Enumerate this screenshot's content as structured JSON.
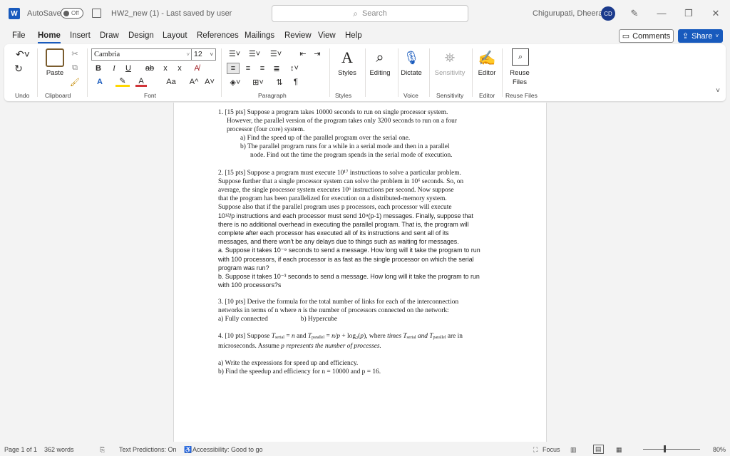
{
  "titlebar": {
    "autosave_label": "AutoSave",
    "autosave_state": "Off",
    "doc_title": "HW2_new (1)  -  Last saved by user",
    "search_placeholder": "Search",
    "user_name": "Chigurupati, Dheeraj",
    "user_initials": "CD"
  },
  "menu": {
    "tabs": [
      "File",
      "Home",
      "Insert",
      "Draw",
      "Design",
      "Layout",
      "References",
      "Mailings",
      "Review",
      "View",
      "Help"
    ],
    "active_tab": "Home",
    "comments_label": "Comments",
    "share_label": "Share"
  },
  "ribbon": {
    "groups": {
      "undo": "Undo",
      "clipboard": "Clipboard",
      "font": "Font",
      "paragraph": "Paragraph",
      "styles": "Styles",
      "voice": "Voice",
      "sensitivity": "Sensitivity",
      "editor": "Editor",
      "reuse_files": "Reuse Files"
    },
    "paste_label": "Paste",
    "font_name": "Cambria",
    "font_size": "12",
    "styles_label": "Styles",
    "editing_label": "Editing",
    "dictate_label": "Dictate",
    "sensitivity_label": "Sensitivity",
    "editor_label": "Editor",
    "reuse_label_1": "Reuse",
    "reuse_label_2": "Files",
    "bold": "B",
    "italic": "I",
    "underline": "U",
    "strike": "ab",
    "subscript": "x",
    "superscript": "x",
    "font_case": "Aa",
    "grow": "A^",
    "shrink": "A˅",
    "pilcrow": "¶"
  },
  "document": {
    "q1_line1": "1.  [15 pts] Suppose a program takes 10000 seconds to run on single processor system.",
    "q1_line2": "However, the parallel version of the program takes only 3200 seconds to run on a four",
    "q1_line3": "processor (four core) system.",
    "q1_a": "a)  Find the speed up of the parallel program over the serial one.",
    "q1_b1": "b)  The parallel program runs for a while in a serial mode and then in a parallel",
    "q1_b2": "node. Find out the time the program spends in the serial mode of execution.",
    "q2_l1": "2. [15 pts] Suppose a program must execute 10¹⁷ instructions to solve a particular problem.",
    "q2_l2": "Suppose further that a single processor system can solve the problem in 10⁶ seconds. So, on",
    "q2_l3": "average, the single processor system executes 10⁶ instructions per second. Now suppose",
    "q2_l4": "that the program has been parallelized for execution on a distributed-memory system.",
    "q2_l5": "Suppose also that if the parallel program uses p processors, each processor will execute",
    "q2_l6": "10¹²/p instructions and each processor must send 10⁹(p-1) messages. Finally, suppose that",
    "q2_l7": "there is no additional overhead in executing the parallel program. That is, the program will",
    "q2_l8": "complete after each processor has executed all of its instructions and sent all of its",
    "q2_l9": "messages, and there won't be any delays due to things such as waiting for messages.",
    "q2_l10": "a. Suppose it takes 10⁻⁹ seconds to send a message. How long will it take the program to run",
    "q2_l11": "with 100 processors, if each processor is as fast as the single processor on which the serial",
    "q2_l12": "program was run?",
    "q2_l13": "b. Suppose it takes 10⁻³ seconds to send a message. How long will it take the program to run",
    "q2_l14": "with 100 processors?s",
    "q3_l1": "3. [10 pts] Derive the formula for the total number of links for each of the interconnection",
    "q3_l2_a": "networks in terms of n where ",
    "q3_l2_n": "n",
    "q3_l2_b": " is the number of processors connected on the network:",
    "q3_a": "a) Fully connected",
    "q3_b": "b) Hypercube",
    "q4_l1_a": "4. [10 pts] Suppose ",
    "q4_T": "T",
    "q4_serial": "serial",
    "q4_l1_b": " = ",
    "q4_n": "n",
    "q4_l1_c": " and ",
    "q4_parallel": "parallel",
    "q4_l1_d": " = ",
    "q4_np": "n/p",
    "q4_l1_e": " + log₂(",
    "q4_p": "p",
    "q4_l1_f": "), where ",
    "q4_times": "times ",
    "q4_and": " and ",
    "q4_are_in": " are in",
    "q4_l2_a": "microseconds. Assume ",
    "q4_l2_b": "p represents the number of processes.",
    "q4_a": "a)  Write the expressions for speed up and efficiency.",
    "q4_b": "b)  Find the speedup and efficiency for n = 10000 and p = 16."
  },
  "status": {
    "page": "Page 1 of 1",
    "words": "362 words",
    "text_predictions": "Text Predictions: On",
    "accessibility": "Accessibility: Good to go",
    "focus": "Focus",
    "zoom": "80%"
  },
  "colors": {
    "accent": "#185abd",
    "window_bg": "#f3f3f3"
  }
}
